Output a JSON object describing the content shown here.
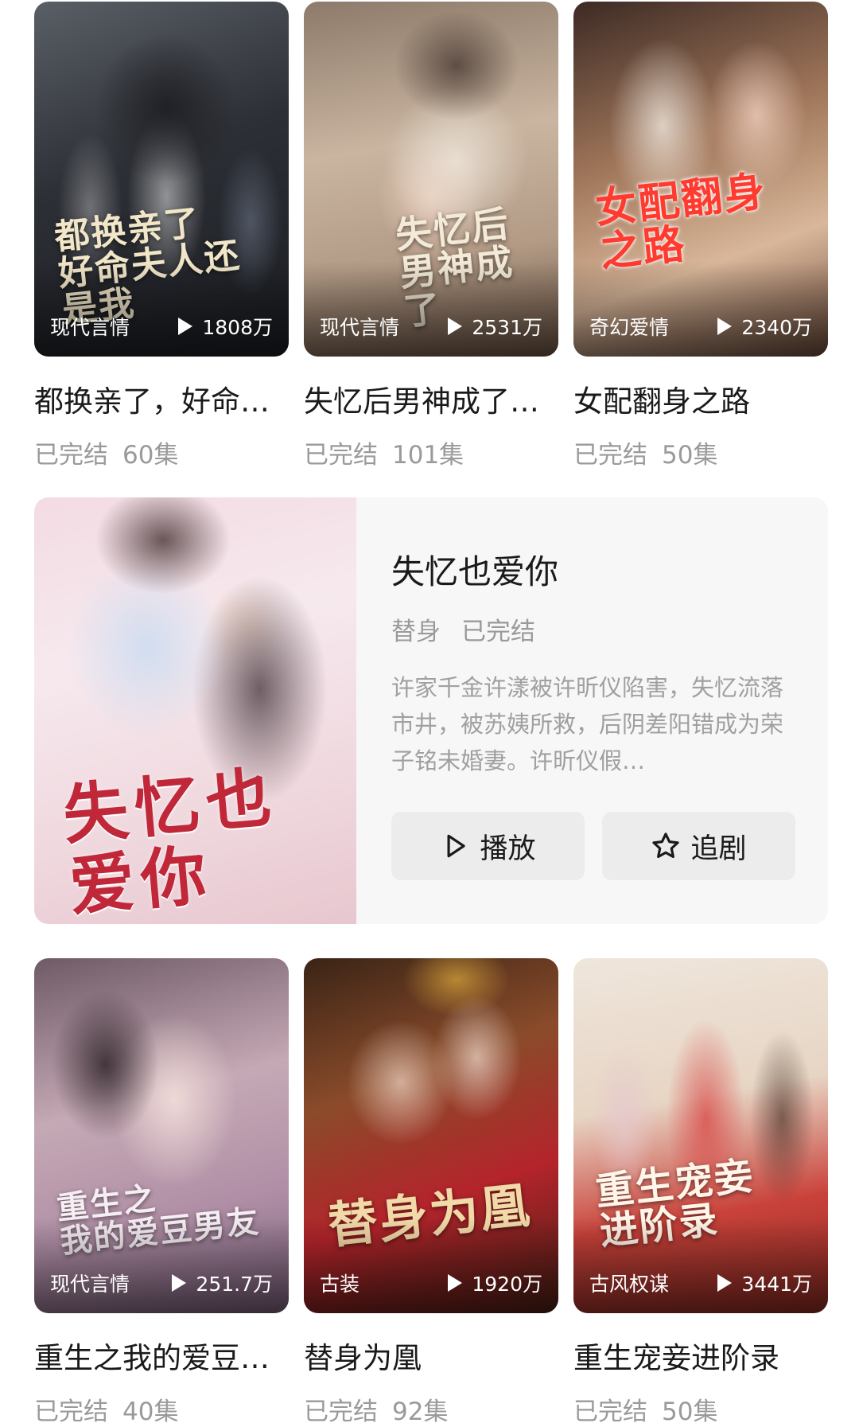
{
  "row1": [
    {
      "title": "都换亲了，好命…",
      "genre": "现代言情",
      "plays": "1808万",
      "status": "已完结",
      "episodes": "60集",
      "art_text": "都换亲了\n好命夫人还是我",
      "art_color": "#f2e6c9"
    },
    {
      "title": "失忆后男神成了…",
      "genre": "现代言情",
      "plays": "2531万",
      "status": "已完结",
      "episodes": "101集",
      "art_text": "失忆后\n男神成了",
      "art_color": "#f3ead8"
    },
    {
      "title": "女配翻身之路",
      "genre": "奇幻爱情",
      "plays": "2340万",
      "status": "已完结",
      "episodes": "50集",
      "art_text": "女配翻身\n之路",
      "art_color": "#ff3b30"
    }
  ],
  "featured": {
    "title": "失忆也爱你",
    "tags": [
      "替身",
      "已完结"
    ],
    "description": "许家千金许漾被许昕仪陷害，失忆流落市井，被苏姨所救，后阴差阳错成为荣子铭未婚妻。许昕仪假…",
    "art_text": "失忆也\n爱你",
    "play_label": "播放",
    "follow_label": "追剧"
  },
  "row2": [
    {
      "title": "重生之我的爱豆…",
      "genre": "现代言情",
      "plays": "251.7万",
      "status": "已完结",
      "episodes": "40集",
      "art_text": "重生之\n我的爱豆男友",
      "art_color": "#f5eef3"
    },
    {
      "title": "替身为凰",
      "genre": "古装",
      "plays": "1920万",
      "status": "已完结",
      "episodes": "92集",
      "art_text": "替身为凰",
      "art_color": "#f1d9a8"
    },
    {
      "title": "重生宠妾进阶录",
      "genre": "古风权谋",
      "plays": "3441万",
      "status": "已完结",
      "episodes": "50集",
      "art_text": "重生宠妾\n进阶录",
      "art_color": "#fff5e8"
    }
  ]
}
